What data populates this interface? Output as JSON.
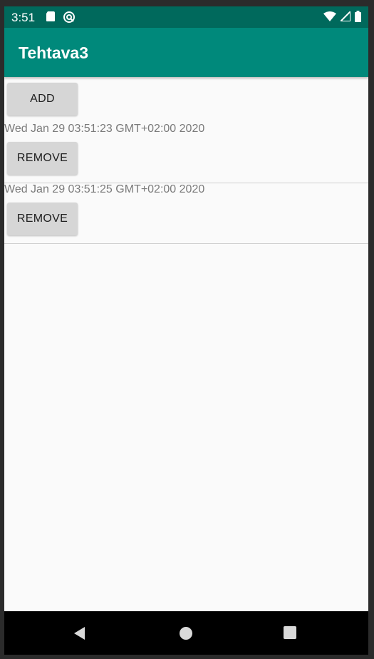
{
  "status_bar": {
    "time": "3:51",
    "left_icons": [
      "sd-card-icon",
      "sync-icon"
    ],
    "right_icons": [
      "wifi-icon",
      "signal-icon",
      "battery-icon"
    ]
  },
  "app_bar": {
    "title": "Tehtava3"
  },
  "main": {
    "add_label": "ADD",
    "items": [
      {
        "date": "Wed Jan 29 03:51:23 GMT+02:00 2020",
        "remove_label": "REMOVE"
      },
      {
        "date": "Wed Jan 29 03:51:25 GMT+02:00 2020",
        "remove_label": "REMOVE"
      }
    ]
  },
  "nav_bar": {
    "icons": [
      "back-icon",
      "home-icon",
      "recents-icon"
    ]
  },
  "colors": {
    "status_bar": "#00695c",
    "app_bar": "#00897b",
    "button": "#d6d6d6",
    "background": "#fafafa"
  }
}
